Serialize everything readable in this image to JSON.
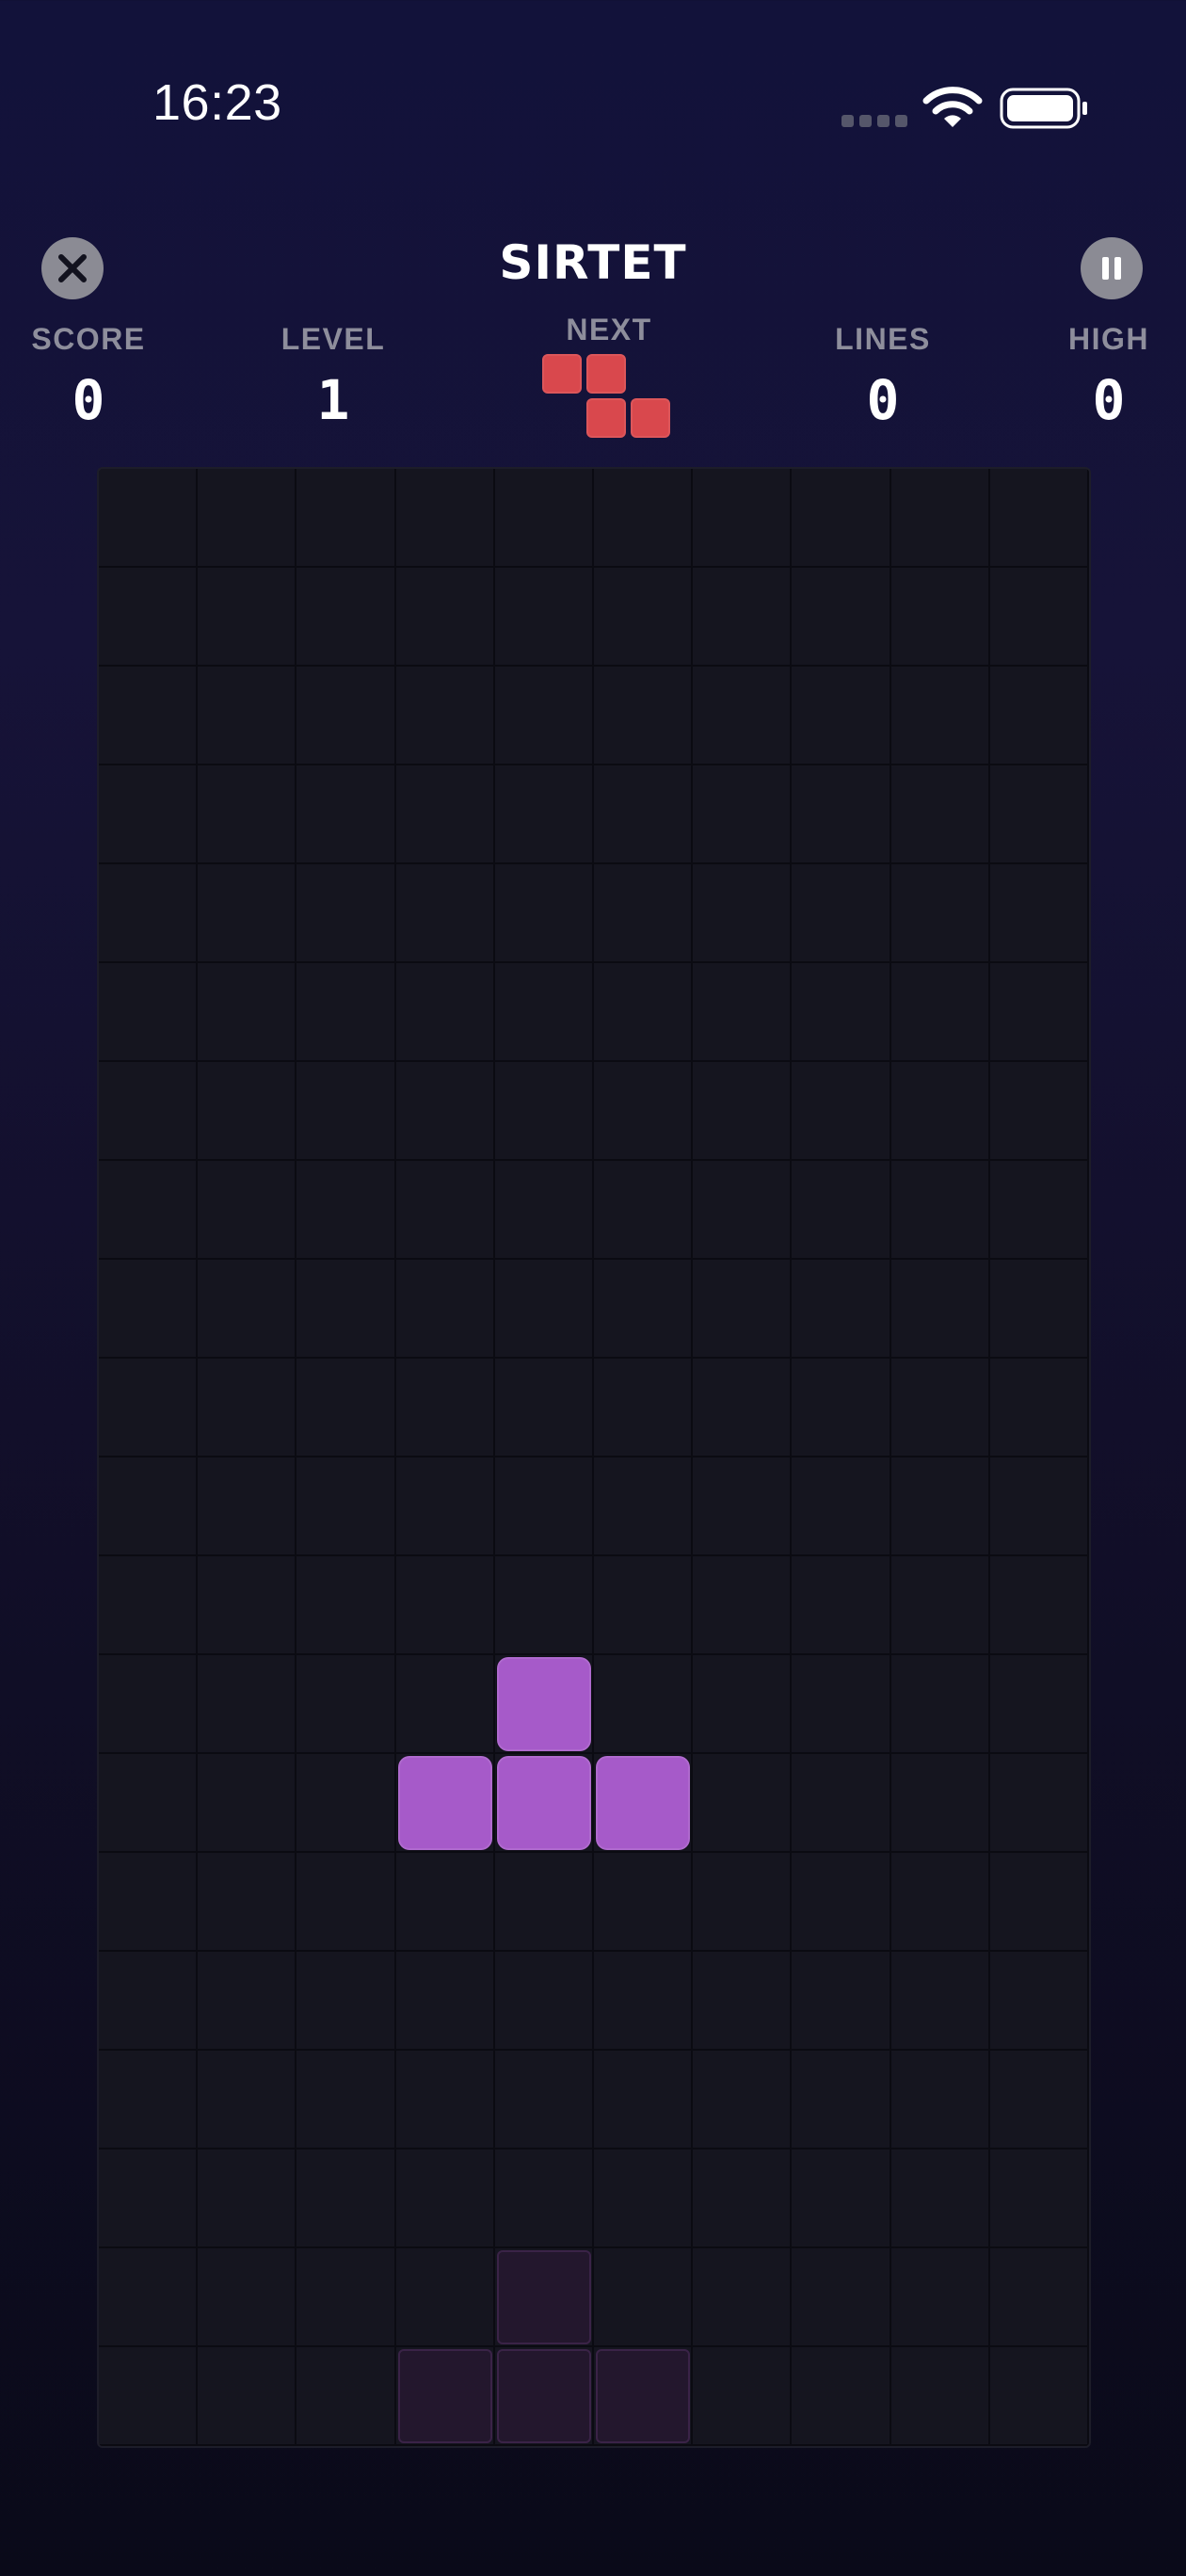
{
  "status_bar": {
    "time": "16:23",
    "icons": [
      "signal-dots-icon",
      "wifi-icon",
      "battery-icon"
    ]
  },
  "header": {
    "title": "SIRTET",
    "close_icon": "close-icon",
    "pause_icon": "pause-icon"
  },
  "stats": {
    "score_label": "SCORE",
    "score_value": "0",
    "level_label": "LEVEL",
    "level_value": "1",
    "next_label": "NEXT",
    "lines_label": "LINES",
    "lines_value": "0",
    "high_label": "HIGH",
    "high_value": "0"
  },
  "next_piece": {
    "shape": "Z",
    "color": "#d9484d",
    "cells": [
      [
        0,
        0
      ],
      [
        1,
        0
      ],
      [
        1,
        1
      ],
      [
        2,
        1
      ]
    ]
  },
  "board": {
    "columns": 10,
    "rows": 20,
    "active_piece": {
      "shape": "T",
      "color": "#a65ac9",
      "cells": [
        [
          4,
          12
        ],
        [
          3,
          13
        ],
        [
          4,
          13
        ],
        [
          5,
          13
        ]
      ]
    },
    "ghost_piece": {
      "color": "#23172d",
      "cells": [
        [
          4,
          18
        ],
        [
          3,
          19
        ],
        [
          4,
          19
        ],
        [
          5,
          19
        ]
      ]
    }
  },
  "colors": {
    "background": "#12123a",
    "board": "#15151f",
    "grid_line": "#0b0b12",
    "label": "#8e8e9c",
    "button": "#8b8b94"
  }
}
